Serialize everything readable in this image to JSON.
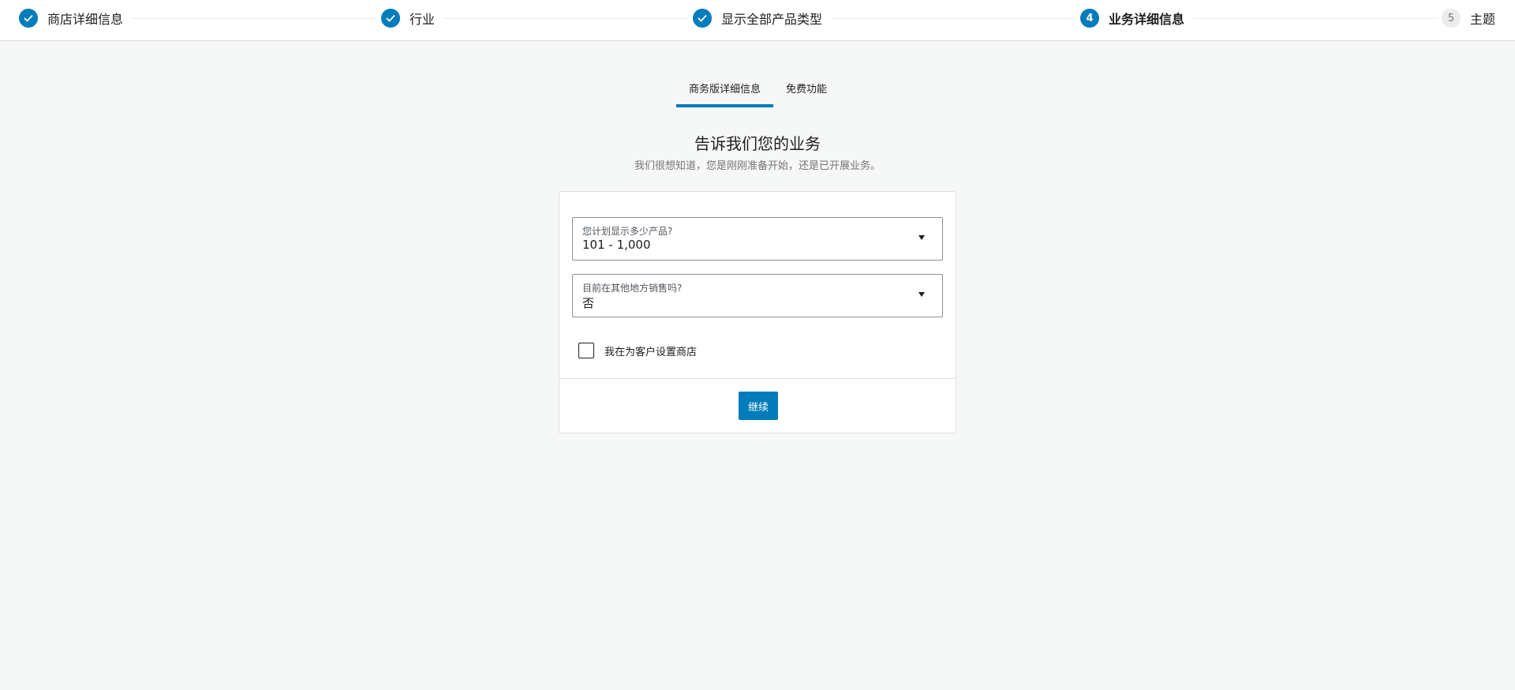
{
  "stepper": {
    "steps": [
      {
        "label": "商店详细信息",
        "status": "done"
      },
      {
        "label": "行业",
        "status": "done"
      },
      {
        "label": "显示全部产品类型",
        "status": "done"
      },
      {
        "label": "业务详细信息",
        "status": "active",
        "number": "4"
      },
      {
        "label": "主题",
        "status": "todo",
        "number": "5"
      }
    ]
  },
  "tabs": [
    {
      "label": "商务版详细信息",
      "active": true
    },
    {
      "label": "免费功能",
      "active": false
    }
  ],
  "heading": "告诉我们您的业务",
  "subheading": "我们很想知道，您是刚刚准备开始，还是已开展业务。",
  "form": {
    "product_count": {
      "label": "您计划显示多少产品?",
      "value": "101 - 1,000"
    },
    "selling_elsewhere": {
      "label": "目前在其他地方销售吗?",
      "value": "否"
    },
    "client_checkbox": {
      "label": "我在为客户设置商店",
      "checked": false
    },
    "continue_label": "继续"
  },
  "colors": {
    "accent": "#007cba",
    "background": "#f6f7f7"
  }
}
